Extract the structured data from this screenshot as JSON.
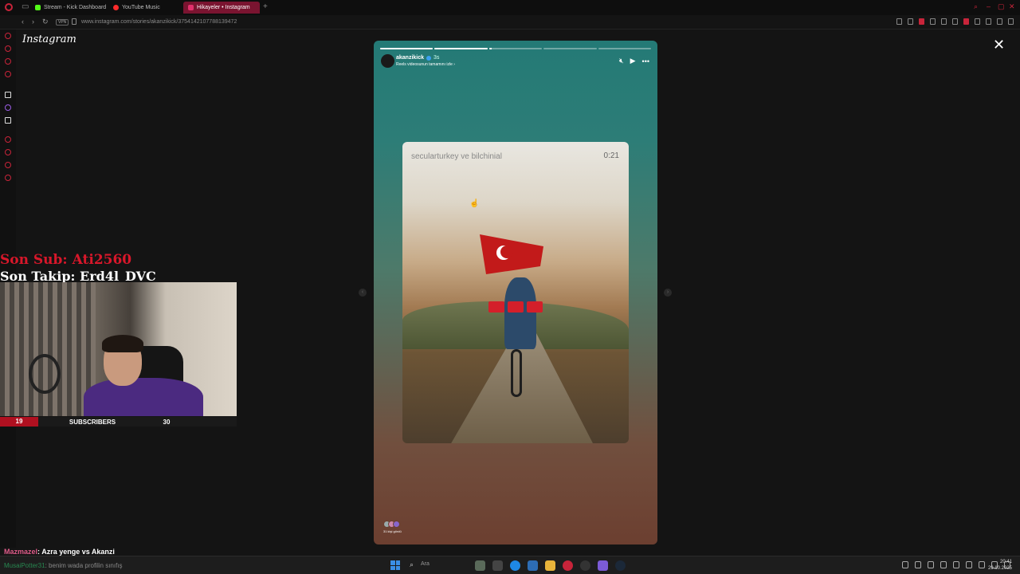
{
  "browser": {
    "tabs": [
      {
        "label": "Stream - Kick Dashboard",
        "favicon_color": "#53fc18"
      },
      {
        "label": "YouTube Music",
        "favicon_color": "#ff2b2b"
      },
      {
        "label": "Hikayeler • Instagram",
        "favicon_color": "#e1306c"
      }
    ],
    "active_tab": 2,
    "vpn_label": "VPN",
    "url": "www.instagram.com/stories/akanzikick/3754142107788139472"
  },
  "instagram": {
    "logo": "Instagram",
    "story": {
      "username": "akanzikick",
      "time": "3s",
      "subtitle": "Reels videosunun tamamını izle ›",
      "progress": [
        1,
        1,
        0.05,
        0,
        0
      ],
      "video_caption": "secularturkey ve bilchinial",
      "video_timer": "0:21",
      "viewers_text": "31 kişi gördü"
    }
  },
  "overlay": {
    "last_sub_label": "Son Sub: Ati2560",
    "last_follow_label": "Son Takip: Erd4l_DVC",
    "sub_left": "19",
    "sub_title": "SUBSCRIBERS",
    "sub_right": "30"
  },
  "chat": [
    {
      "name": "Mazmazel",
      "message": ": Azra yenge vs Akanzi"
    },
    {
      "name": "MusaiPotter31",
      "message": ": benim wada profilin sınıfış"
    }
  ],
  "taskbar": {
    "search_placeholder": "Ara",
    "time": "20:41",
    "date": "29.10.2025"
  }
}
